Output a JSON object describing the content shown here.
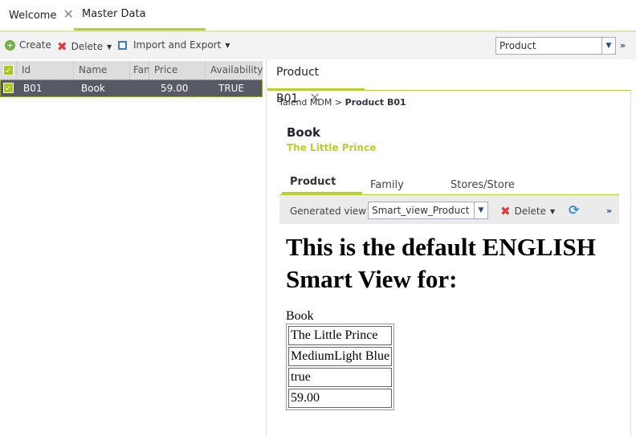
{
  "tabs": [
    {
      "label": "Welcome"
    },
    {
      "label": "Master Data Browser",
      "active": true
    }
  ],
  "toolbar": {
    "create": "Create",
    "delete": "Delete",
    "import_export": "Import and Export",
    "entity_select": "Product"
  },
  "grid": {
    "headers": [
      "Id",
      "Name",
      "Fan",
      "Price",
      "Availability"
    ],
    "rows": [
      {
        "id": "B01",
        "name": "Book",
        "family": "",
        "price": "59.00",
        "availability": "TRUE",
        "selected": true
      }
    ]
  },
  "detail": {
    "tab": "Product B01",
    "breadcrumb_root": "Talend MDM",
    "breadcrumb_sep": ">",
    "breadcrumb_current": "Product B01",
    "title": "Book",
    "subtitle": "The Little Prince",
    "subtabs": [
      "Product",
      "Family",
      "Stores/Store"
    ],
    "view_label": "Generated view",
    "view_select": "Smart_view_Product te",
    "delete": "Delete",
    "smartview": {
      "heading": "This is the default ENGLISH Smart View for:",
      "name": "Book",
      "cells": [
        "The Little Prince",
        "MediumLight Blue",
        "true",
        "59.00"
      ]
    }
  },
  "colors": {
    "accent": "#b9d12e",
    "row_selected": "#555a64"
  }
}
